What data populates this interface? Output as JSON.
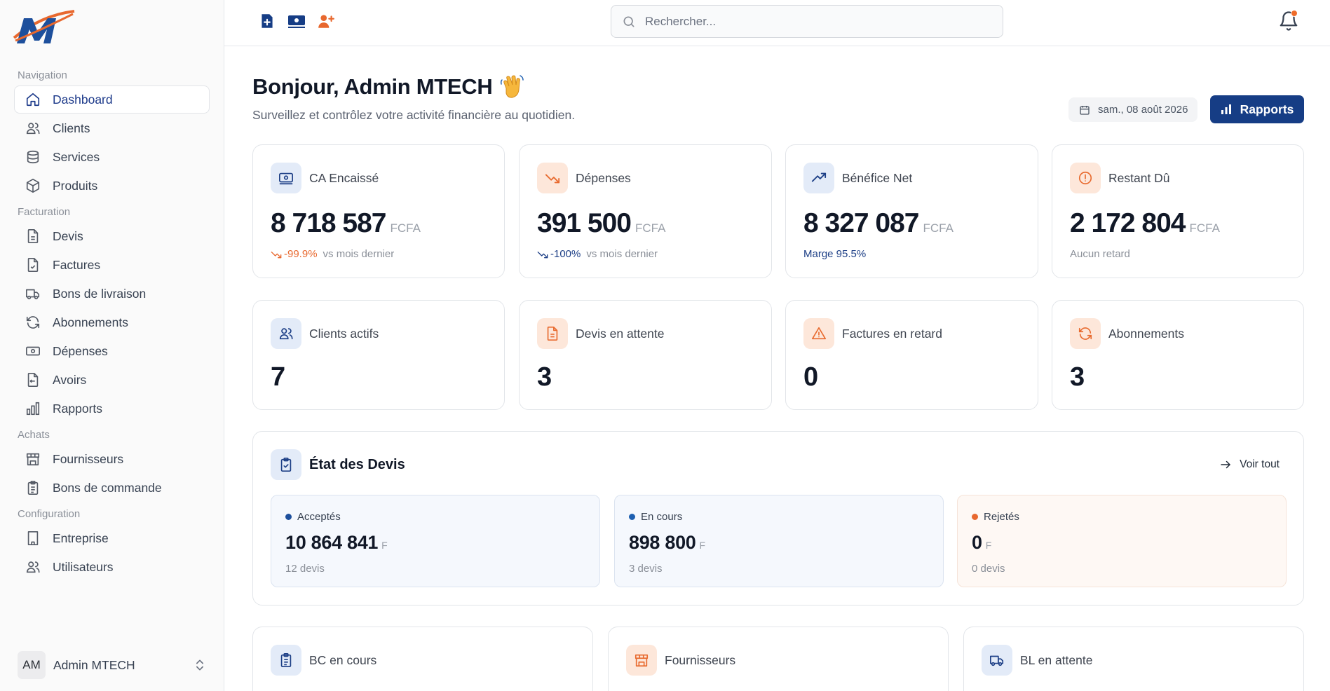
{
  "sidebar": {
    "brand_initial": "M",
    "sections": [
      {
        "title": "Navigation",
        "items": [
          {
            "label": "Dashboard",
            "icon": "home-icon",
            "active": true
          },
          {
            "label": "Clients",
            "icon": "users-icon"
          },
          {
            "label": "Services",
            "icon": "database-icon"
          },
          {
            "label": "Produits",
            "icon": "box-icon"
          }
        ]
      },
      {
        "title": "Facturation",
        "items": [
          {
            "label": "Devis",
            "icon": "file-icon"
          },
          {
            "label": "Factures",
            "icon": "file-check-icon"
          },
          {
            "label": "Bons de livraison",
            "icon": "truck-icon"
          },
          {
            "label": "Abonnements",
            "icon": "refresh-icon"
          },
          {
            "label": "Dépenses",
            "icon": "banknote-icon"
          },
          {
            "label": "Avoirs",
            "icon": "receipt-icon"
          },
          {
            "label": "Rapports",
            "icon": "bar-chart-icon"
          }
        ]
      },
      {
        "title": "Achats",
        "items": [
          {
            "label": "Fournisseurs",
            "icon": "store-icon"
          },
          {
            "label": "Bons de commande",
            "icon": "clipboard-list-icon"
          }
        ]
      },
      {
        "title": "Configuration",
        "items": [
          {
            "label": "Entreprise",
            "icon": "building-icon"
          },
          {
            "label": "Utilisateurs",
            "icon": "users-icon"
          }
        ]
      }
    ],
    "user": {
      "initials": "AM",
      "name": "Admin MTECH"
    }
  },
  "topbar": {
    "search_placeholder": "Rechercher..."
  },
  "header": {
    "greeting": "Bonjour, Admin MTECH",
    "subtitle": "Surveillez et contrôlez votre activité financière au quotidien.",
    "date": "sam., 08 août 2026",
    "reports_button": "Rapports"
  },
  "kpis": {
    "ca": {
      "label": "CA Encaissé",
      "value": "8 718 587",
      "unit": "FCFA",
      "trend": "-99.9%",
      "trend_note": "vs mois dernier"
    },
    "depenses": {
      "label": "Dépenses",
      "value": "391 500",
      "unit": "FCFA",
      "trend": "-100%",
      "trend_note": "vs mois dernier"
    },
    "benefice": {
      "label": "Bénéfice Net",
      "value": "8 327 087",
      "unit": "FCFA",
      "note": "Marge 95.5%"
    },
    "restant": {
      "label": "Restant Dû",
      "value": "2 172 804",
      "unit": "FCFA",
      "note": "Aucun retard"
    }
  },
  "counters": {
    "clients": {
      "label": "Clients actifs",
      "value": "7"
    },
    "devis": {
      "label": "Devis en attente",
      "value": "3"
    },
    "factures": {
      "label": "Factures en retard",
      "value": "0"
    },
    "abonnements": {
      "label": "Abonnements",
      "value": "3"
    }
  },
  "devis_status": {
    "title": "État des Devis",
    "link": "Voir tout",
    "items": [
      {
        "label": "Acceptés",
        "value": "10 864 841",
        "unit": "F",
        "count": "12 devis",
        "color": "#1d4f9c"
      },
      {
        "label": "En cours",
        "value": "898 800",
        "unit": "F",
        "count": "3 devis",
        "color": "#1d5fb0"
      },
      {
        "label": "Rejetés",
        "value": "0",
        "unit": "F",
        "count": "0 devis",
        "color": "#e8682e"
      }
    ]
  },
  "bottom_cards": [
    {
      "label": "BC en cours"
    },
    {
      "label": "Fournisseurs"
    },
    {
      "label": "BL en attente"
    }
  ],
  "colors": {
    "primary": "#163d85",
    "accent": "#e8682e"
  }
}
